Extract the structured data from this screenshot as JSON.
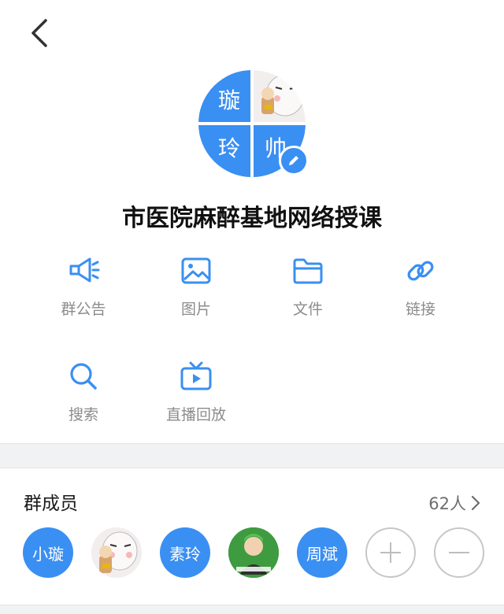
{
  "header": {
    "back_icon": "chevron-left-icon"
  },
  "group": {
    "name": "市医院麻醉基地网络授课",
    "avatar_chars": [
      "璇",
      "玲",
      "帅"
    ],
    "edit_icon": "pencil-icon",
    "accent_color": "#3a8ff2"
  },
  "features": [
    {
      "label": "群公告",
      "icon": "megaphone-icon"
    },
    {
      "label": "图片",
      "icon": "image-icon"
    },
    {
      "label": "文件",
      "icon": "folder-icon"
    },
    {
      "label": "链接",
      "icon": "link-icon"
    },
    {
      "label": "搜索",
      "icon": "search-icon"
    },
    {
      "label": "直播回放",
      "icon": "tv-play-icon"
    }
  ],
  "members": {
    "title": "群成员",
    "count": "62人",
    "list": [
      {
        "type": "text",
        "label": "小璇"
      },
      {
        "type": "image",
        "icon": "cartoon-avatar"
      },
      {
        "type": "text",
        "label": "素玲"
      },
      {
        "type": "image",
        "icon": "green-photo-avatar"
      },
      {
        "type": "text",
        "label": "周斌"
      }
    ],
    "add_icon": "plus-icon",
    "remove_icon": "minus-icon"
  }
}
